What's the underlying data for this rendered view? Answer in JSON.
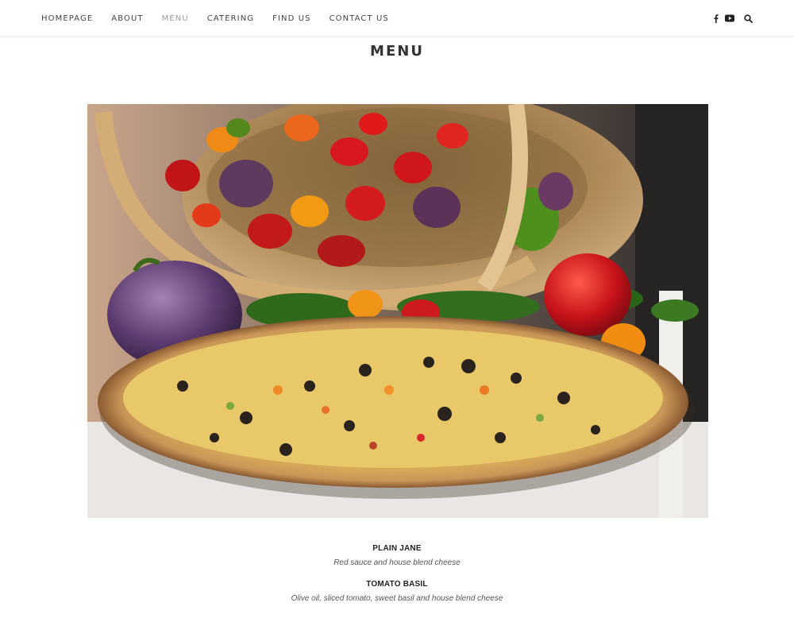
{
  "nav": {
    "links": [
      {
        "label": "HOMEPAGE",
        "active": false
      },
      {
        "label": "ABOUT",
        "active": false
      },
      {
        "label": "MENU",
        "active": true
      },
      {
        "label": "CATERING",
        "active": false
      },
      {
        "label": "FIND US",
        "active": false
      },
      {
        "label": "CONTACT US",
        "active": false
      }
    ],
    "icons": [
      "facebook-icon",
      "youtube-icon",
      "search-icon"
    ]
  },
  "page": {
    "title": "MENU"
  },
  "hero": {
    "image": "pizza-with-peppers-basket-photo"
  },
  "menu": {
    "items": [
      {
        "name": "PLAIN JANE",
        "description": "Red sauce and house blend cheese"
      },
      {
        "name": "TOMATO BASIL",
        "description": "Olive oil, sliced tomato, sweet basil and house blend cheese"
      }
    ]
  },
  "colors": {
    "nav_text": "#444444",
    "nav_active": "#9a9a9a",
    "title": "#333333"
  }
}
